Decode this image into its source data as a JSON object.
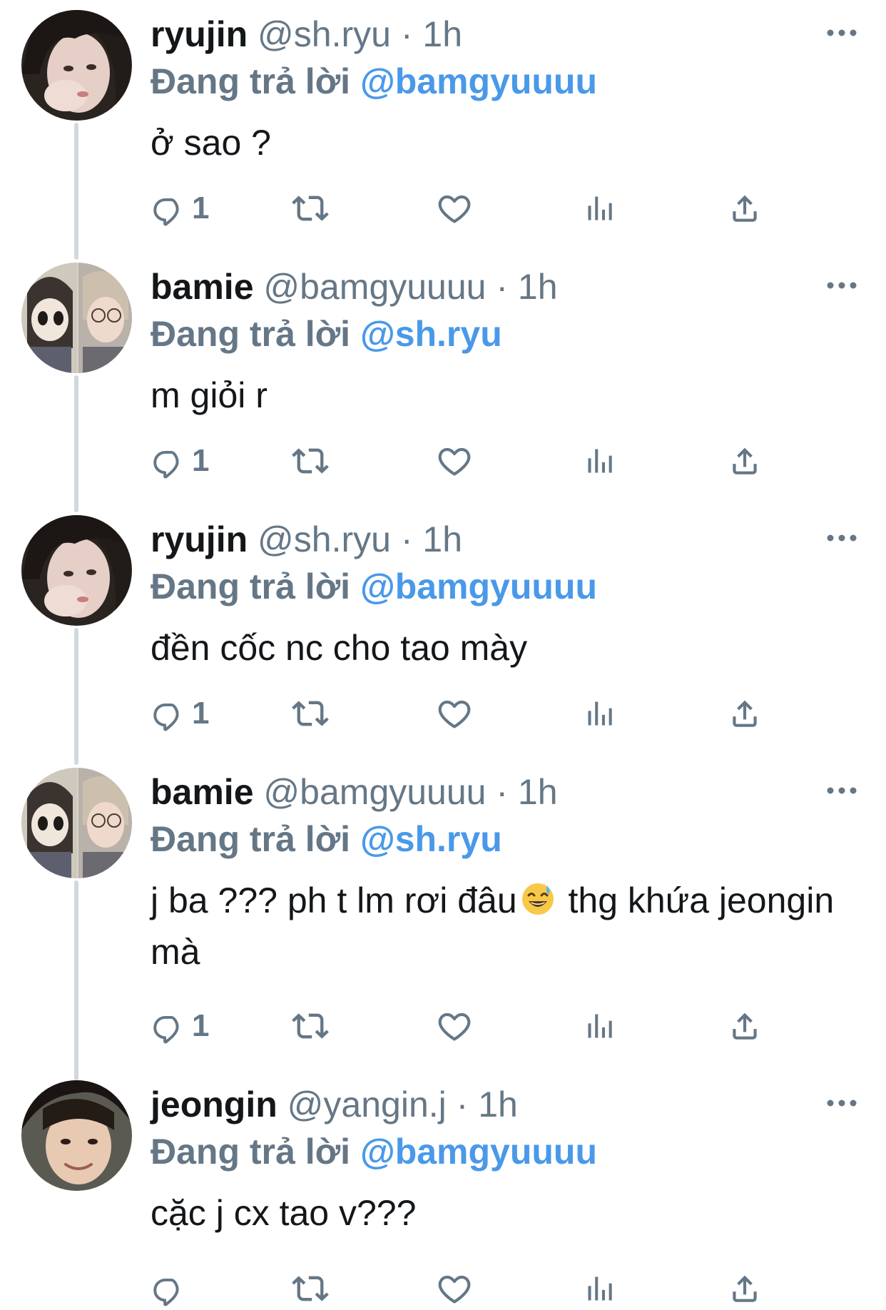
{
  "colors": {
    "name": "#14171a",
    "muted": "#657786",
    "mention": "#4a99e9",
    "thread_line": "#cfd9de"
  },
  "icons": {
    "more": "more-dots-icon",
    "reply": "reply-icon",
    "retweet": "retweet-icon",
    "like": "like-heart-icon",
    "views": "analytics-icon",
    "share": "share-icon",
    "emoji": "grinning-sweat-emoji-icon"
  },
  "tweets": [
    {
      "display_name": "ryujin",
      "meta": "@sh.ryu · 1h",
      "replying_label": "Đang trả lời",
      "replying_to": "@bamgyuuuu",
      "text": "ở sao ?",
      "reply_count": "1"
    },
    {
      "display_name": "bamie",
      "meta": "@bamgyuuuu · 1h",
      "replying_label": "Đang trả lời",
      "replying_to": "@sh.ryu",
      "text": "m giỏi r",
      "reply_count": "1"
    },
    {
      "display_name": "ryujin",
      "meta": "@sh.ryu · 1h",
      "replying_label": "Đang trả lời",
      "replying_to": "@bamgyuuuu",
      "text": "đền cốc nc cho tao mày",
      "reply_count": "1"
    },
    {
      "display_name": "bamie",
      "meta": "@bamgyuuuu · 1h",
      "replying_label": "Đang trả lời",
      "replying_to": "@sh.ryu",
      "text_before_emoji": "j ba ??? ph t lm rơi đâu",
      "text_after_emoji": " thg khứa jeongin mà",
      "reply_count": "1"
    },
    {
      "display_name": "jeongin",
      "meta": "@yangin.j · 1h",
      "replying_label": "Đang trả lời",
      "replying_to": "@bamgyuuuu",
      "text": "cặc j cx tao v???",
      "reply_count": ""
    }
  ]
}
